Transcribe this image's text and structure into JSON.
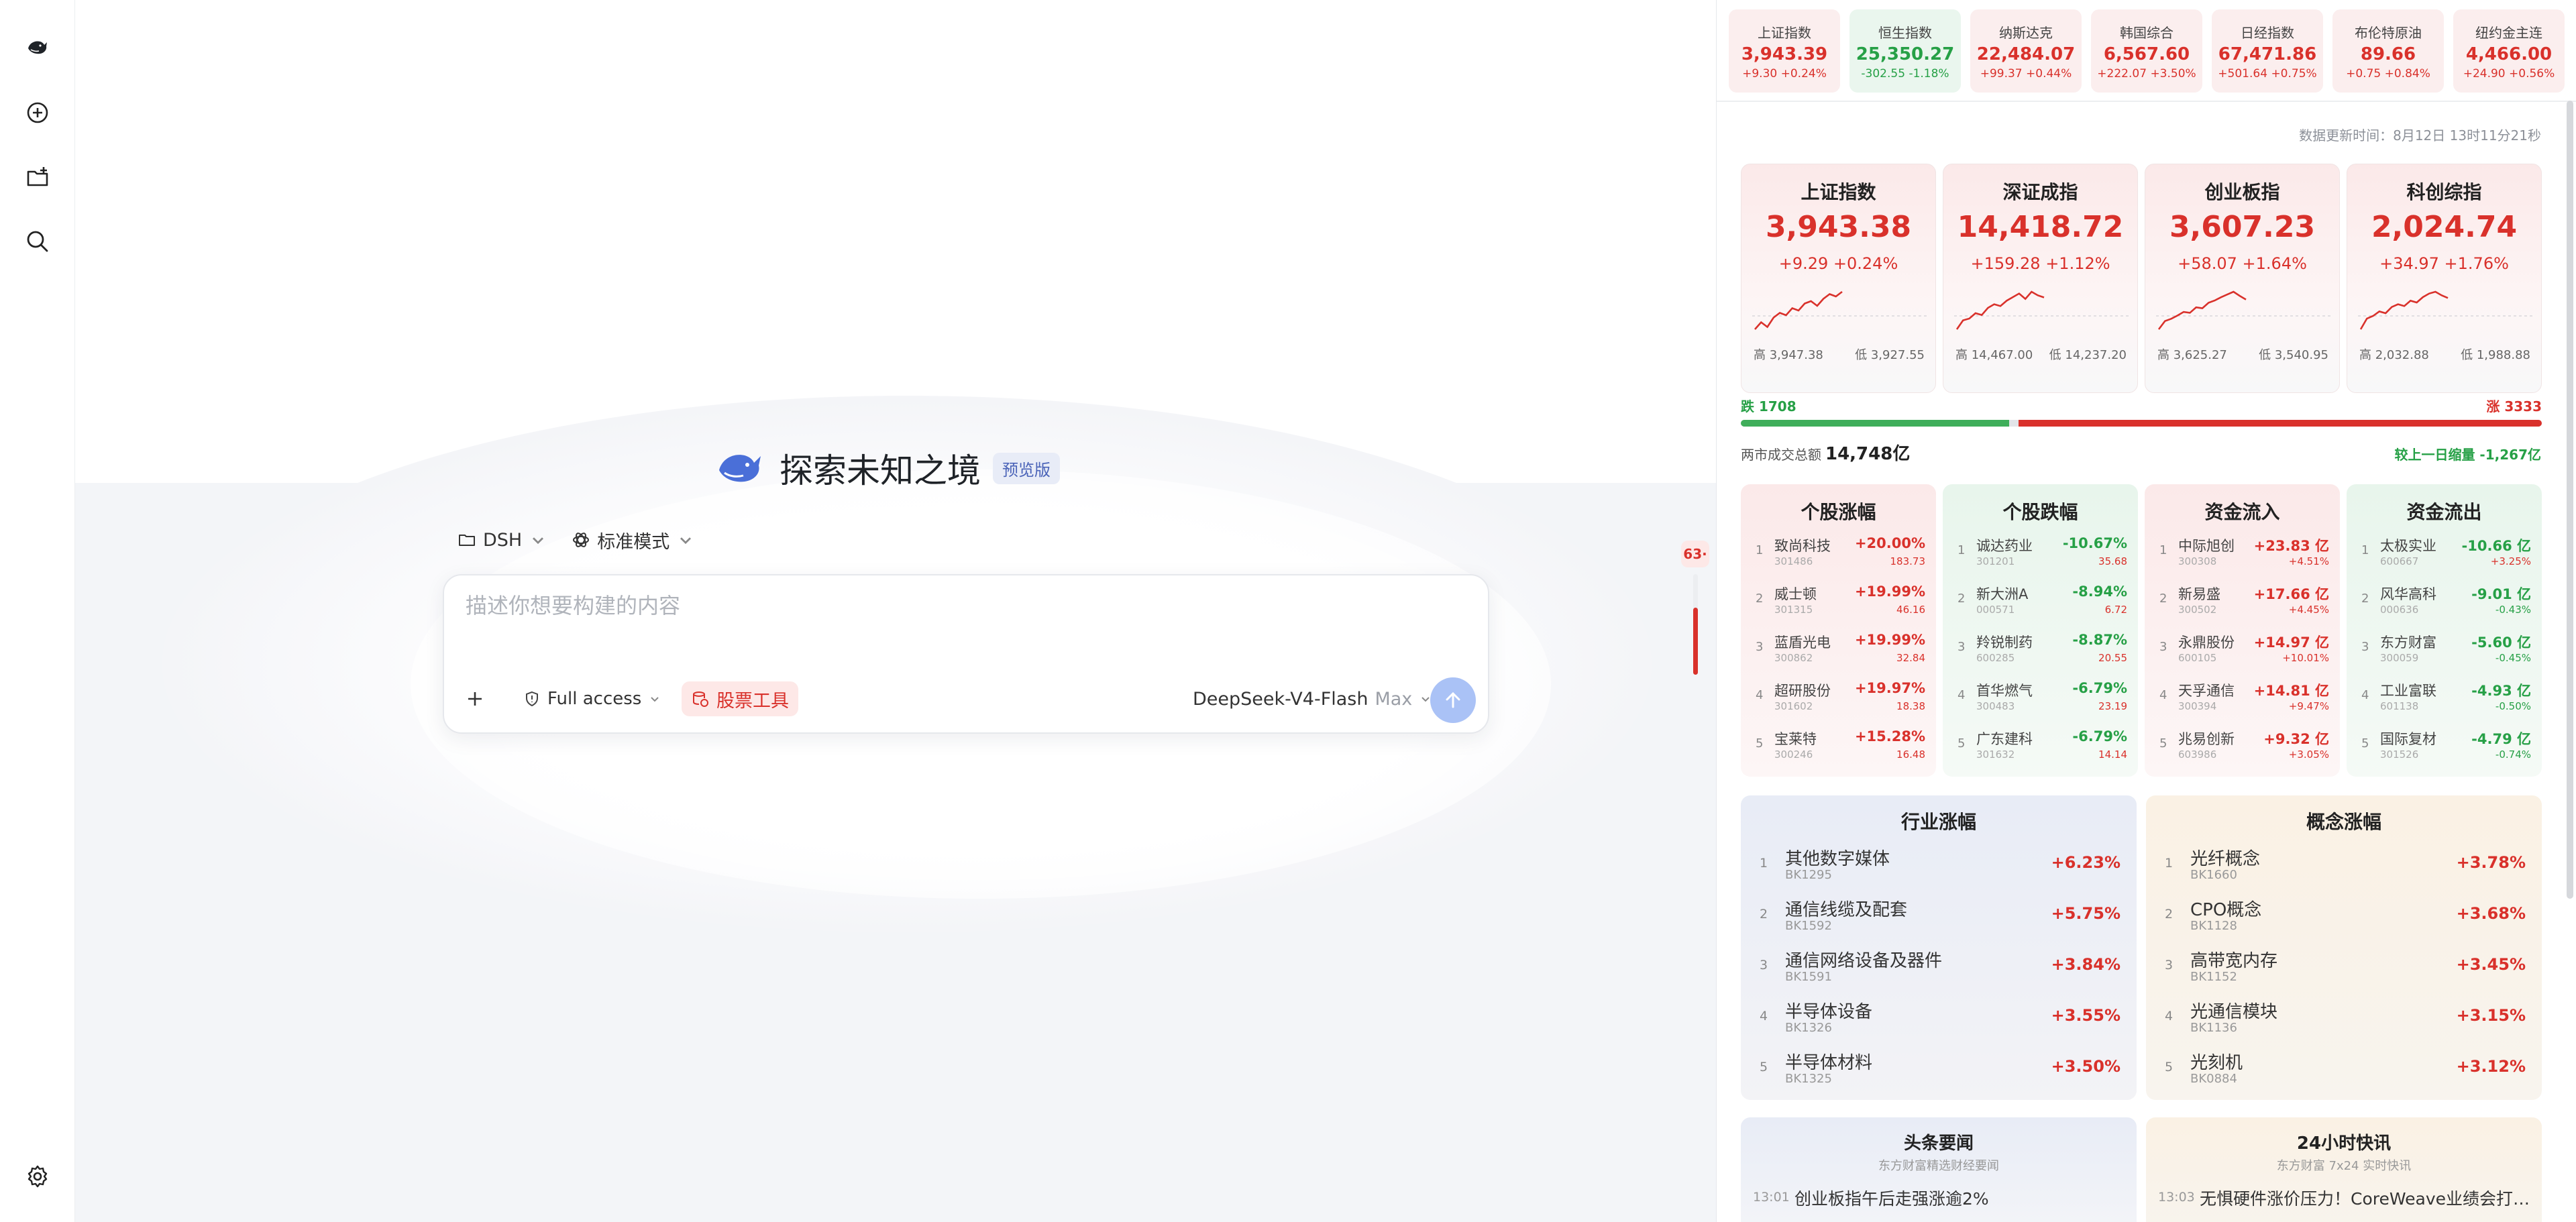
{
  "app": {
    "hero_title": "探索未知之境",
    "hero_badge": "预览版"
  },
  "rail": {
    "items": [
      {
        "icon": "whale-logo-icon"
      },
      {
        "icon": "new-chat-icon"
      },
      {
        "icon": "new-project-icon"
      },
      {
        "icon": "search-icon"
      },
      {
        "icon": "settings-icon"
      }
    ]
  },
  "toolbar": {
    "project_label": "DSH",
    "mode_label": "标准模式"
  },
  "composer": {
    "placeholder": "描述你想要构建的内容",
    "access_label": "Full access",
    "stock_tool_label": "股票工具",
    "model_label": "DeepSeek-V4-Flash",
    "model_tier": "Max"
  },
  "scroll_badge": "63·",
  "ticker": [
    {
      "name": "上证指数",
      "price": "3,943.39",
      "change": "+9.30",
      "pct": "+0.24%",
      "dir": "up"
    },
    {
      "name": "恒生指数",
      "price": "25,350.27",
      "change": "-302.55",
      "pct": "-1.18%",
      "dir": "down"
    },
    {
      "name": "纳斯达克",
      "price": "22,484.07",
      "change": "+99.37",
      "pct": "+0.44%",
      "dir": "up"
    },
    {
      "name": "韩国综合",
      "price": "6,567.60",
      "change": "+222.07",
      "pct": "+3.50%",
      "dir": "up"
    },
    {
      "name": "日经指数",
      "price": "67,471.86",
      "change": "+501.64",
      "pct": "+0.75%",
      "dir": "up"
    },
    {
      "name": "布伦特原油",
      "price": "89.66",
      "change": "+0.75",
      "pct": "+0.84%",
      "dir": "up"
    },
    {
      "name": "纽约金主连",
      "price": "4,466.00",
      "change": "+24.90",
      "pct": "+0.56%",
      "dir": "up"
    }
  ],
  "update_time": "数据更新时间：8月12日 13时11分21秒",
  "indices": [
    {
      "name": "上证指数",
      "price": "3,943.38",
      "change": "+9.29",
      "pct": "+0.24%",
      "high": "高 3,947.38",
      "low": "低 3,927.55",
      "spark": [
        3928,
        3931,
        3929,
        3933,
        3935,
        3934,
        3937,
        3936,
        3939,
        3940,
        3938,
        3941,
        3943,
        3942,
        3944
      ]
    },
    {
      "name": "深证成指",
      "price": "14,418.72",
      "change": "+159.28",
      "pct": "+1.12%",
      "high": "高 14,467.00",
      "low": "低 14,237.20",
      "spark": [
        14240,
        14290,
        14300,
        14330,
        14320,
        14360,
        14380,
        14370,
        14400,
        14420,
        14440,
        14410,
        14450,
        14430,
        14418
      ]
    },
    {
      "name": "创业板指",
      "price": "3,607.23",
      "change": "+58.07",
      "pct": "+1.64%",
      "high": "高 3,625.27",
      "low": "低 3,540.95",
      "spark": [
        3542,
        3560,
        3565,
        3572,
        3580,
        3578,
        3590,
        3588,
        3600,
        3605,
        3612,
        3618,
        3624,
        3615,
        3607
      ]
    },
    {
      "name": "科创综指",
      "price": "2,024.74",
      "change": "+34.97",
      "pct": "+1.76%",
      "high": "高 2,032.88",
      "low": "低 1,988.88",
      "spark": [
        1990,
        2002,
        2005,
        2010,
        2008,
        2015,
        2018,
        2016,
        2022,
        2020,
        2026,
        2030,
        2032,
        2028,
        2025
      ]
    }
  ],
  "breadth": {
    "down_label": "跌 1708",
    "up_label": "涨 3333",
    "down": 1708,
    "flat": 60,
    "up": 3333
  },
  "turnover": {
    "label": "两市成交总额",
    "value": "14,748亿",
    "change": "较上一日缩量 -1,267亿"
  },
  "movers": [
    {
      "title": "个股涨幅",
      "tone": "up",
      "rows": [
        {
          "name": "致尚科技",
          "code": "301486",
          "v1": "+20.00%",
          "v2": "183.73"
        },
        {
          "name": "威士顿",
          "code": "301315",
          "v1": "+19.99%",
          "v2": "46.16"
        },
        {
          "name": "蓝盾光电",
          "code": "300862",
          "v1": "+19.99%",
          "v2": "32.84"
        },
        {
          "name": "超研股份",
          "code": "301602",
          "v1": "+19.97%",
          "v2": "18.38"
        },
        {
          "name": "宝莱特",
          "code": "300246",
          "v1": "+15.28%",
          "v2": "16.48"
        }
      ]
    },
    {
      "title": "个股跌幅",
      "tone": "down",
      "rows": [
        {
          "name": "诚达药业",
          "code": "301201",
          "v1": "-10.67%",
          "v2": "35.68"
        },
        {
          "name": "新大洲A",
          "code": "000571",
          "v1": "-8.94%",
          "v2": "6.72"
        },
        {
          "name": "羚锐制药",
          "code": "600285",
          "v1": "-8.87%",
          "v2": "20.55"
        },
        {
          "name": "首华燃气",
          "code": "300483",
          "v1": "-6.79%",
          "v2": "23.19"
        },
        {
          "name": "广东建科",
          "code": "301632",
          "v1": "-6.79%",
          "v2": "14.14"
        }
      ]
    },
    {
      "title": "资金流入",
      "tone": "up",
      "rows": [
        {
          "name": "中际旭创",
          "code": "300308",
          "v1": "+23.83 亿",
          "v2": "+4.51%"
        },
        {
          "name": "新易盛",
          "code": "300502",
          "v1": "+17.66 亿",
          "v2": "+4.45%"
        },
        {
          "name": "永鼎股份",
          "code": "600105",
          "v1": "+14.97 亿",
          "v2": "+10.01%"
        },
        {
          "name": "天孚通信",
          "code": "300394",
          "v1": "+14.81 亿",
          "v2": "+9.47%"
        },
        {
          "name": "兆易创新",
          "code": "603986",
          "v1": "+9.32 亿",
          "v2": "+3.05%"
        }
      ]
    },
    {
      "title": "资金流出",
      "tone": "down",
      "rows": [
        {
          "name": "太极实业",
          "code": "600667",
          "v1": "-10.66 亿",
          "v2": "+3.25%"
        },
        {
          "name": "风华高科",
          "code": "000636",
          "v1": "-9.01 亿",
          "v2": "-0.43%"
        },
        {
          "name": "东方财富",
          "code": "300059",
          "v1": "-5.60 亿",
          "v2": "-0.45%"
        },
        {
          "name": "工业富联",
          "code": "601138",
          "v1": "-4.93 亿",
          "v2": "-0.50%"
        },
        {
          "name": "国际复材",
          "code": "301526",
          "v1": "-4.79 亿",
          "v2": "-0.74%"
        }
      ]
    }
  ],
  "sectors": [
    {
      "title": "行业涨幅",
      "rows": [
        {
          "name": "其他数字媒体",
          "code": "BK1295",
          "v": "+6.23%"
        },
        {
          "name": "通信线缆及配套",
          "code": "BK1592",
          "v": "+5.75%"
        },
        {
          "name": "通信网络设备及器件",
          "code": "BK1591",
          "v": "+3.84%"
        },
        {
          "name": "半导体设备",
          "code": "BK1326",
          "v": "+3.55%"
        },
        {
          "name": "半导体材料",
          "code": "BK1325",
          "v": "+3.50%"
        }
      ]
    },
    {
      "title": "概念涨幅",
      "rows": [
        {
          "name": "光纤概念",
          "code": "BK1660",
          "v": "+3.78%"
        },
        {
          "name": "CPO概念",
          "code": "BK1128",
          "v": "+3.68%"
        },
        {
          "name": "高带宽内存",
          "code": "BK1152",
          "v": "+3.45%"
        },
        {
          "name": "光通信模块",
          "code": "BK1136",
          "v": "+3.15%"
        },
        {
          "name": "光刻机",
          "code": "BK0884",
          "v": "+3.12%"
        }
      ]
    }
  ],
  "news": [
    {
      "title": "头条要闻",
      "sub": "东方财富精选财经要闻",
      "time": "13:01",
      "text": "创业板指午后走强涨逾2%"
    },
    {
      "title": "24小时快讯",
      "sub": "东方财富 7x24 实时快讯",
      "time": "13:03",
      "text": "无惧硬件涨价压力！CoreWeave业绩会打消..."
    }
  ],
  "colors": {
    "up": "#d9312b",
    "down": "#26a046",
    "accent": "#4a6fd8"
  }
}
